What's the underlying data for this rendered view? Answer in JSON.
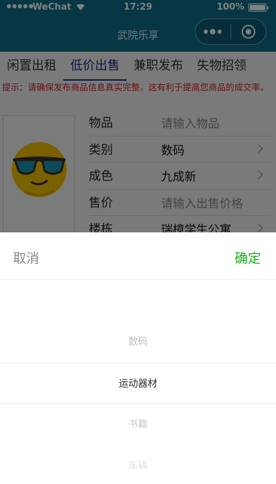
{
  "status_bar": {
    "carrier": "WeChat",
    "time": "17:29",
    "battery": "100%"
  },
  "nav": {
    "title": "武院乐享"
  },
  "tabs": [
    {
      "label": "闲置出租"
    },
    {
      "label": "低价出售"
    },
    {
      "label": "兼职发布"
    },
    {
      "label": "失物招领"
    }
  ],
  "tip": "提示：请确保发布商品信息真实完整，这有利于提高您商品的成交率。",
  "form": {
    "rows": [
      {
        "label": "物品",
        "value": "请输入物品"
      },
      {
        "label": "类别",
        "value": "数码"
      },
      {
        "label": "成色",
        "value": "九成新"
      },
      {
        "label": "售价",
        "value": "请输入出售价格"
      },
      {
        "label": "楼栋",
        "value": "瑞樟学生公寓"
      }
    ]
  },
  "picker": {
    "cancel": "取消",
    "confirm": "确定",
    "options": [
      "数码",
      "运动器材",
      "书籍",
      "车辆"
    ],
    "selected": "运动器材"
  },
  "colors": {
    "nav_bg": "#0f6e8a",
    "tab_active": "#1b2f8c",
    "tip": "#d8202a",
    "confirm": "#1aad19"
  }
}
